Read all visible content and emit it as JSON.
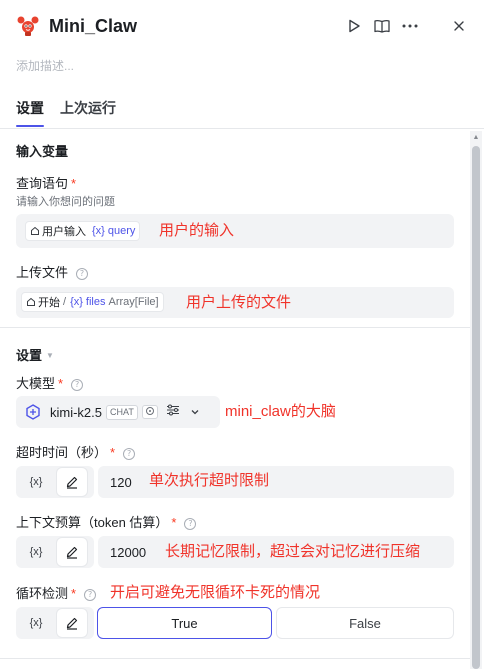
{
  "header": {
    "title": "Mini_Claw",
    "description_placeholder": "添加描述..."
  },
  "tabs": [
    {
      "label": "设置",
      "active": true
    },
    {
      "label": "上次运行",
      "active": false
    }
  ],
  "input_section": {
    "title": "输入变量",
    "query": {
      "label": "查询语句",
      "required": true,
      "hint": "请输入你想问的问题",
      "source_node": "用户输入",
      "var_prefix": "{x}",
      "var_name": "query",
      "annotation": "用户的输入"
    },
    "files": {
      "label": "上传文件",
      "source_node": "开始",
      "separator": "/",
      "var_prefix": "{x}",
      "var_name": "files",
      "var_type": "Array[File]",
      "annotation": "用户上传的文件"
    }
  },
  "settings": {
    "title": "设置",
    "model": {
      "label": "大模型",
      "required": true,
      "name": "kimi-k2.5",
      "chip": "CHAT",
      "annotation": "mini_claw的大脑"
    },
    "timeout": {
      "label": "超时时间（秒）",
      "required": true,
      "var_icon": "{x}",
      "value": "120",
      "annotation": "单次执行超时限制"
    },
    "context_budget": {
      "label": "上下文预算（token 估算）",
      "required": true,
      "var_icon": "{x}",
      "value": "12000",
      "annotation": "长期记忆限制，超过会对记忆进行压缩"
    },
    "loop_detect": {
      "label": "循环检测",
      "required": true,
      "var_icon": "{x}",
      "annotation": "开启可避免无限循环卡死的情况",
      "options": [
        "True",
        "False"
      ],
      "selected": "True"
    }
  },
  "colors": {
    "accent": "#4d53e8",
    "required": "#f93920",
    "annotation": "#f0332a"
  }
}
